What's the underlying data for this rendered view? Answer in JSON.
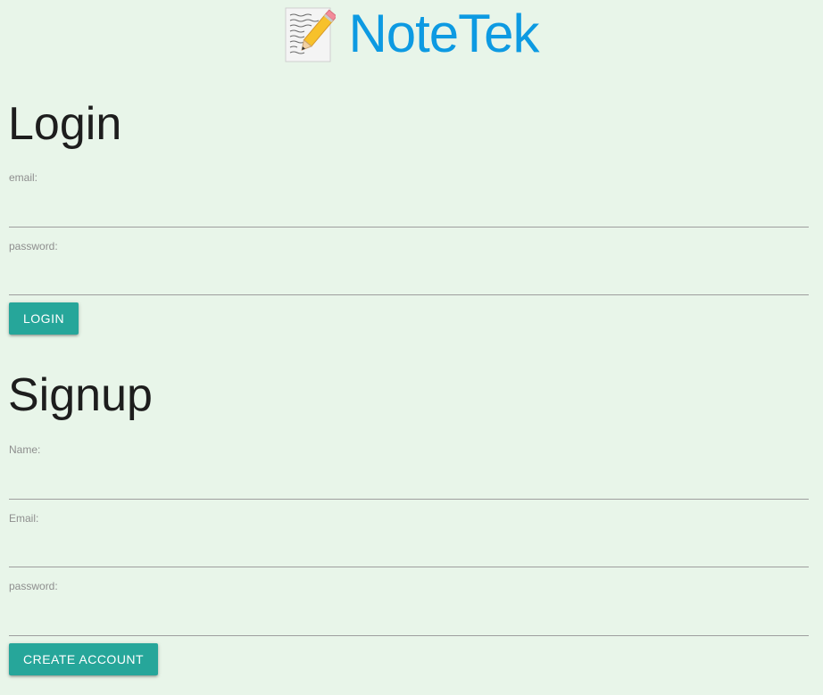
{
  "header": {
    "app_name": "NoteTek",
    "icon": "memo-icon"
  },
  "login": {
    "title": "Login",
    "email_label": "email:",
    "email_value": "",
    "password_label": "password:",
    "password_value": "",
    "button_label": "LOGIN"
  },
  "signup": {
    "title": "Signup",
    "name_label": "Name:",
    "name_value": "",
    "email_label": "Email:",
    "email_value": "",
    "password_label": "password:",
    "password_value": "",
    "button_label": "CREATE ACCOUNT"
  },
  "colors": {
    "background": "#e8f5e9",
    "brand": "#0d9ae2",
    "button": "#26a69a"
  }
}
